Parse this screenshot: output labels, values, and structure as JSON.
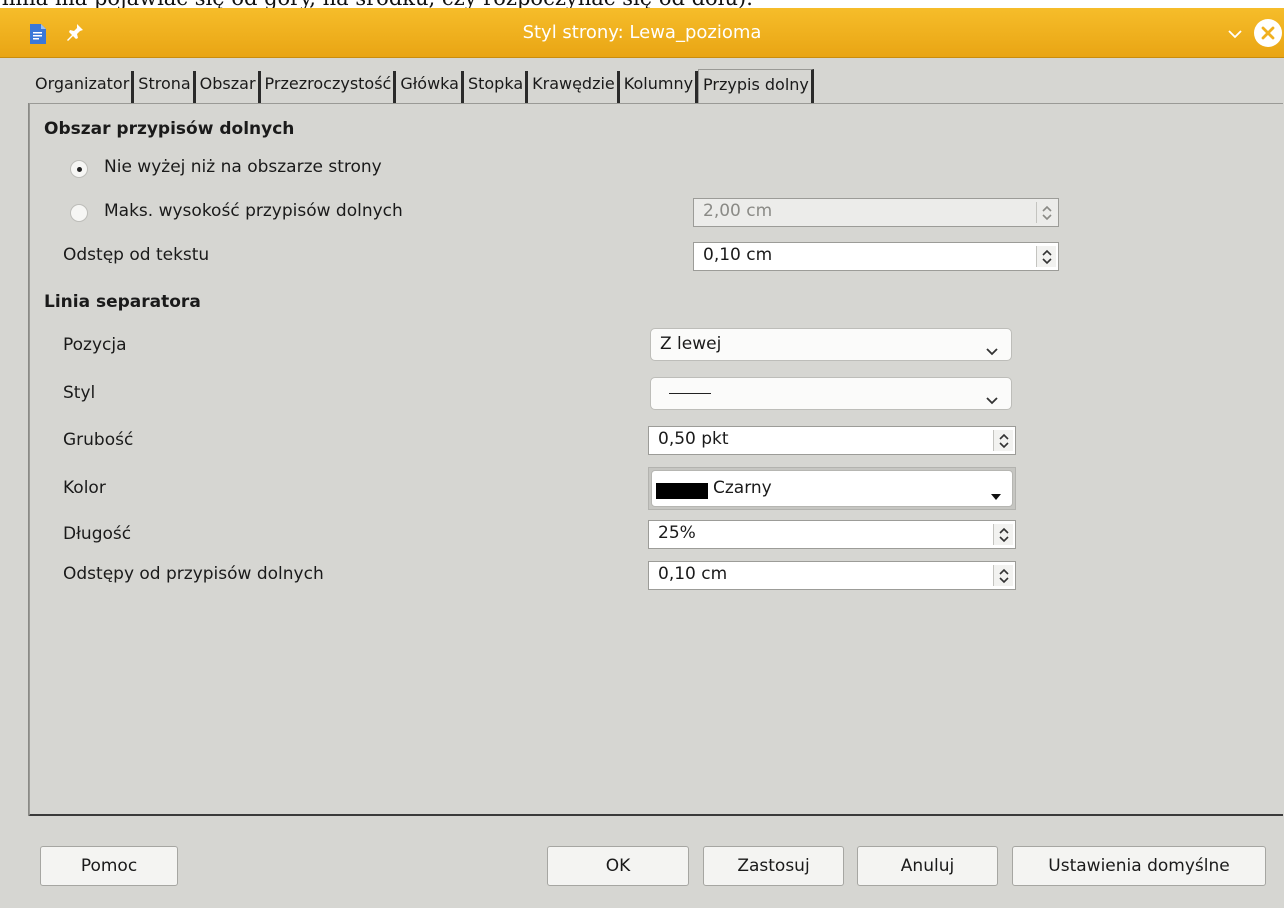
{
  "background_doc": {
    "text": "linia ma pojawiać się od góry, na środku, czy rozpoczynać się od dołu)."
  },
  "window": {
    "title": "Styl strony: Lewa_pozioma",
    "accent_color": "#f0b020"
  },
  "tabs": [
    {
      "label": "Organizator",
      "active": false
    },
    {
      "label": "Strona",
      "active": false
    },
    {
      "label": "Obszar",
      "active": false
    },
    {
      "label": "Przezroczystość",
      "active": false
    },
    {
      "label": "Główka",
      "active": false
    },
    {
      "label": "Stopka",
      "active": false
    },
    {
      "label": "Krawędzie",
      "active": false
    },
    {
      "label": "Kolumny",
      "active": false
    },
    {
      "label": "Przypis dolny",
      "active": true
    }
  ],
  "footnote_area": {
    "title": "Obszar przypisów dolnych",
    "radio_page_area": {
      "label": "Nie wyżej niż na obszarze strony",
      "checked": true
    },
    "radio_max_height": {
      "label": "Maks. wysokość przypisów dolnych",
      "checked": false,
      "value": "2,00 cm",
      "enabled": false
    },
    "spacing_label": "Odstęp od tekstu",
    "spacing_value": "0,10 cm"
  },
  "separator": {
    "title": "Linia separatora",
    "position_label": "Pozycja",
    "position_value": "Z lewej",
    "style_label": "Styl",
    "weight_label": "Grubość",
    "weight_value": "0,50 pkt",
    "color_label": "Kolor",
    "color_value": "Czarny",
    "color_hex": "#000000",
    "length_label": "Długość",
    "length_value": "25%",
    "spacing_label": "Odstępy od przypisów dolnych",
    "spacing_value": "0,10 cm"
  },
  "buttons": {
    "help": "Pomoc",
    "ok": "OK",
    "apply": "Zastosuj",
    "cancel": "Anuluj",
    "defaults": "Ustawienia domyślne"
  }
}
